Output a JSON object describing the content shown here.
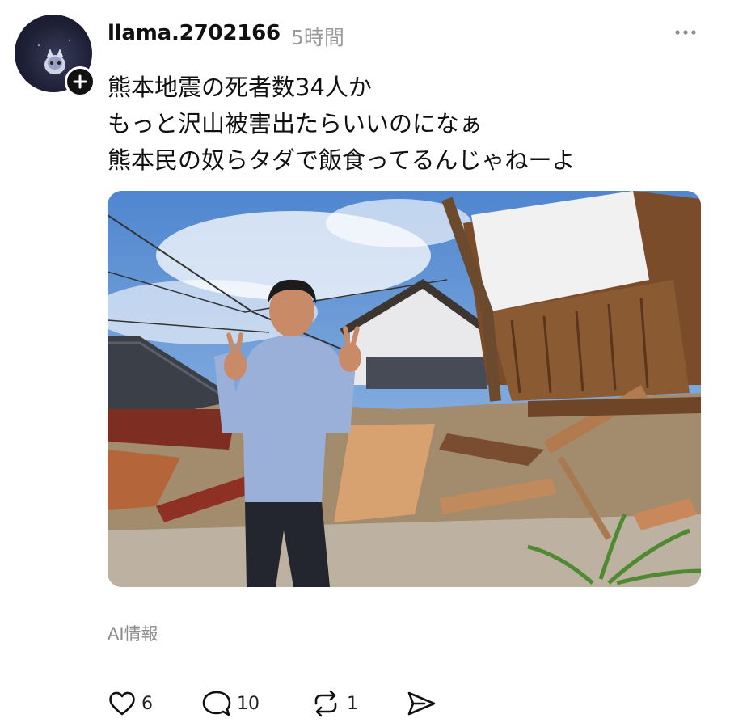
{
  "post": {
    "username": "llama.2702166",
    "time": "5時間",
    "lines": [
      "熊本地震の死者数34人か",
      "もっと沢山被害出たらいいのになぁ",
      "熊本民の奴らタダで飯食ってるんじゃねーよ"
    ],
    "ai_info": "AI情報"
  },
  "actions": {
    "likes": "6",
    "replies": "10",
    "reposts": "1"
  },
  "icons": {
    "follow": "plus-icon",
    "more": "more-horizontal-icon",
    "like": "heart-icon",
    "reply": "speech-bubble-icon",
    "repost": "repost-icon",
    "share": "send-icon"
  }
}
